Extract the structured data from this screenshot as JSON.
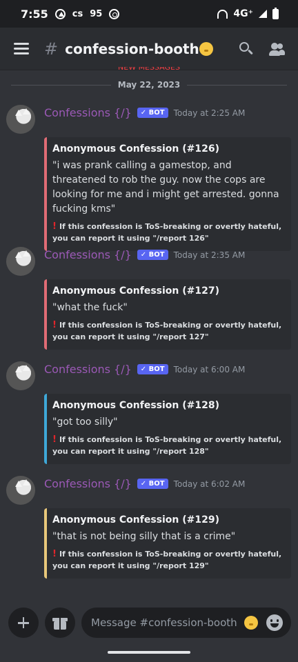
{
  "status_bar": {
    "time": "7:55",
    "small_label": "95",
    "network": "4G⁺"
  },
  "header": {
    "hash": "#",
    "channel": "confession-booth"
  },
  "new_messages_label": "NEW MESSAGES",
  "date_divider": "May 22, 2023",
  "bot": {
    "name": "Confessions {/}",
    "badge": "✓ BOT"
  },
  "colors": {
    "accent_red": "#e06c75",
    "accent_blue": "#3ea8d8",
    "accent_yellow": "#e8c77a",
    "bot_name": "#9b59b6",
    "badge": "#5865f2"
  },
  "messages": [
    {
      "time": "Today at 2:25 AM",
      "title": "Anonymous Confession (#126)",
      "text": "\"i was prank calling a gamestop, and threatened to rob the guy. now the cops are looking for me and i might get arrested. gonna fucking kms\"",
      "footer": "If this confession is ToS-breaking or overtly hateful, you can report it using \"/report 126\""
    },
    {
      "time": "Today at 2:35 AM",
      "title": "Anonymous Confession (#127)",
      "text": "\"what the fuck\"",
      "footer": "If this confession is ToS-breaking or overtly hateful, you can report it using \"/report 127\""
    },
    {
      "time": "Today at 6:00 AM",
      "title": "Anonymous Confession (#128)",
      "text": "\"got too silly\"",
      "footer": "If this confession is ToS-breaking or overtly hateful, you can report it using \"/report 128\""
    },
    {
      "time": "Today at 6:02 AM",
      "title": "Anonymous Confession (#129)",
      "text": "\"that is not being silly that is a crime\"",
      "footer": "If this confession is ToS-breaking or overtly hateful, you can report it using \"/report 129\""
    }
  ],
  "composer": {
    "placeholder": "Message #confession-booth"
  },
  "icons": [
    "menu-icon",
    "search-icon",
    "members-icon",
    "plus-icon",
    "gift-icon",
    "emoji-icon",
    "warning-icon"
  ]
}
